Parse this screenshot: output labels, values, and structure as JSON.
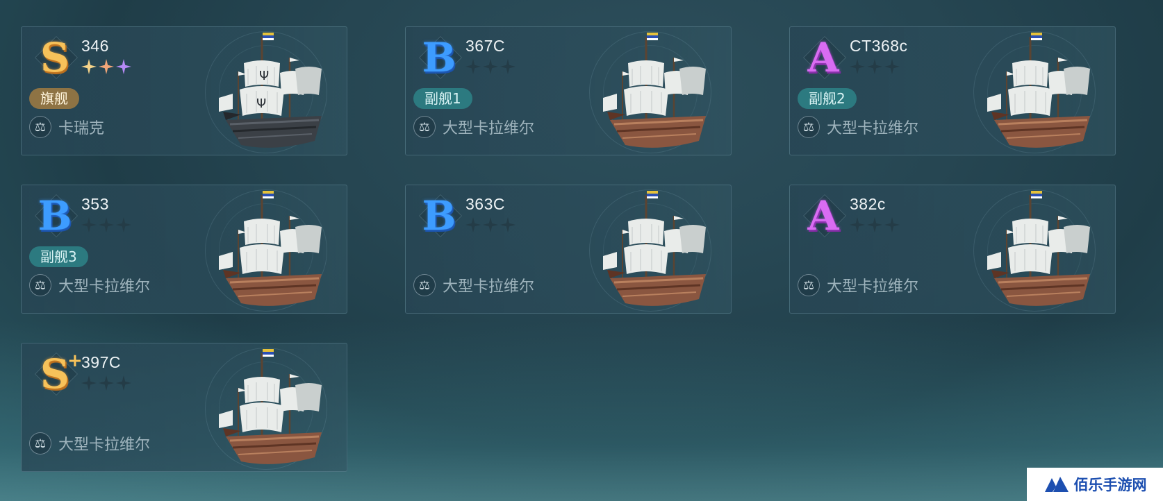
{
  "ships": [
    {
      "grade": "S",
      "grade_class": "S",
      "name": "346",
      "stars": [
        "s1",
        "s2",
        "s3"
      ],
      "tag": "旗舰",
      "tag_class": "flag",
      "type_icon": "⚖",
      "type": "卡瑞克",
      "hull": "dark"
    },
    {
      "grade": "B",
      "grade_class": "B",
      "name": "367C",
      "stars": [
        "",
        "",
        ""
      ],
      "tag": "副舰1",
      "tag_class": "escort",
      "type_icon": "⚖",
      "type": "大型卡拉维尔",
      "hull": "wood"
    },
    {
      "grade": "A",
      "grade_class": "A",
      "name": "CT368c",
      "stars": [
        "",
        "",
        ""
      ],
      "tag": "副舰2",
      "tag_class": "escort",
      "type_icon": "⚖",
      "type": "大型卡拉维尔",
      "hull": "wood"
    },
    {
      "grade": "B",
      "grade_class": "B",
      "name": "353",
      "stars": [
        "",
        "",
        ""
      ],
      "tag": "副舰3",
      "tag_class": "escort",
      "type_icon": "⚖",
      "type": "大型卡拉维尔",
      "hull": "wood"
    },
    {
      "grade": "B",
      "grade_class": "B",
      "name": "363C",
      "stars": [
        "",
        "",
        ""
      ],
      "tag": "",
      "tag_class": "",
      "type_icon": "⚖",
      "type": "大型卡拉维尔",
      "hull": "wood"
    },
    {
      "grade": "A",
      "grade_class": "A",
      "name": "382c",
      "stars": [
        "",
        "",
        ""
      ],
      "tag": "",
      "tag_class": "",
      "type_icon": "⚖",
      "type": "大型卡拉维尔",
      "hull": "wood"
    },
    {
      "grade": "S",
      "grade_class": "S",
      "plus": "+",
      "name": "397C",
      "stars": [
        "",
        "",
        ""
      ],
      "tag": "",
      "tag_class": "",
      "type_icon": "⚖",
      "type": "大型卡拉维尔",
      "hull": "wood"
    }
  ],
  "watermark": {
    "text": "佰乐手游网"
  }
}
